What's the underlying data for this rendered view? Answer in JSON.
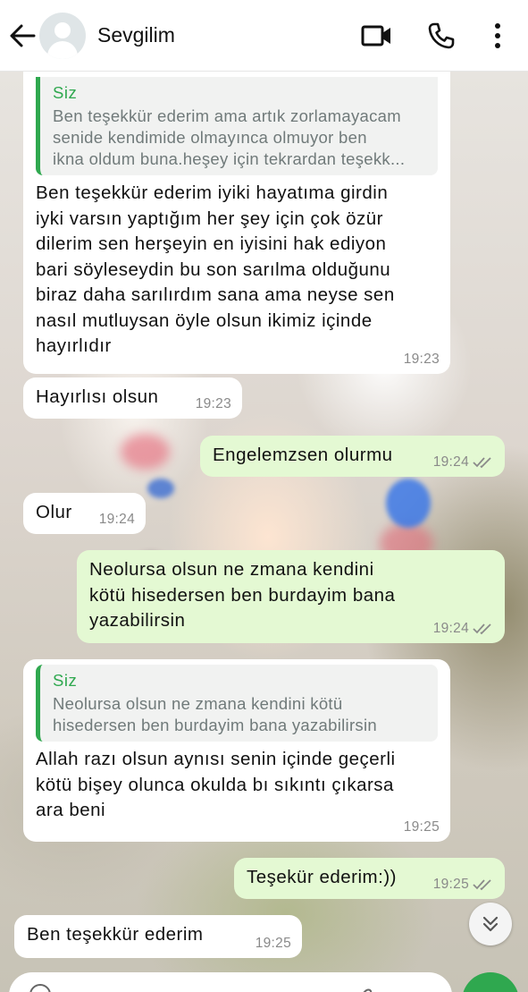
{
  "header": {
    "contact_name": "Sevgilim"
  },
  "icons": {
    "back": "arrow-left-icon",
    "video": "video-camera-icon",
    "call": "phone-icon",
    "more": "more-vertical-icon",
    "scroll_down": "double-chevron-down-icon"
  },
  "colors": {
    "outgoing_bubble": "#e4f9d3",
    "incoming_bubble": "#ffffff",
    "accent_green": "#2fa84f",
    "read_ticks": "#8a8a8a"
  },
  "messages": [
    {
      "direction": "in",
      "quote_name": "Siz",
      "quote_text": [
        "Ben teşekkür ederim ama artık zorlamayacam",
        "senide kendimide olmayınca olmuyor ben",
        "ikna oldum buna.heşey için tekrardan teşekk..."
      ],
      "text": [
        "Ben teşekkür ederim iyiki  hayatıma girdin",
        "iyki varsın yaptığım her şey için çok özür",
        "dilerim sen herşeyin en iyisini hak ediyon",
        "bari söyleseydin bu son sarılma olduğunu",
        "biraz daha sarılırdım sana ama neyse sen",
        "nasıl mutluysan öyle olsun ikimiz içinde",
        "hayırlıdır"
      ],
      "time": "19:23"
    },
    {
      "direction": "in",
      "text": "Hayırlısı olsun",
      "time": "19:23"
    },
    {
      "direction": "out",
      "text": "Engelemzsen olurmu",
      "time": "19:24"
    },
    {
      "direction": "in",
      "text": "Olur",
      "time": "19:24"
    },
    {
      "direction": "out",
      "text": [
        "Neolursa olsun ne zmana kendini",
        "kötü hisedersen ben burdayim bana",
        "yazabilirsin"
      ],
      "time": "19:24"
    },
    {
      "direction": "in",
      "quote_name": "Siz",
      "quote_text": [
        "Neolursa olsun ne zmana kendini kötü",
        "hisedersen ben burdayim bana yazabilirsin"
      ],
      "text": [
        "Allah razı olsun aynısı senin içinde geçerli",
        "kötü bişey olunca okulda bı sıkıntı çıkarsa",
        "ara beni"
      ],
      "time": "19:25"
    },
    {
      "direction": "out",
      "text": "Teşekür ederim:))",
      "time": "19:25"
    },
    {
      "direction": "in",
      "text": "Ben teşekkür ederim",
      "time": "19:25"
    }
  ]
}
